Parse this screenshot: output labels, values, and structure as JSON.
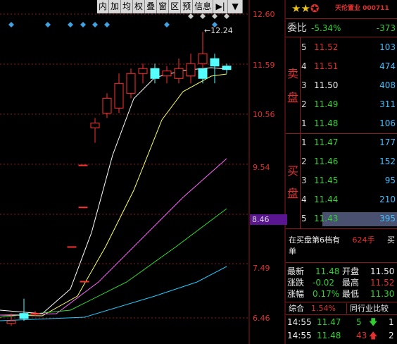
{
  "toolbar": [
    "内",
    "加",
    "均",
    "权",
    "叠",
    "窗",
    "区",
    "预",
    "信息",
    "▶|",
    "▼"
  ],
  "price_ticks": [
    "12.60",
    "11.59",
    "10.56",
    "9.54",
    "8.46",
    "7.49",
    "6.46"
  ],
  "current_price_label": "8.46",
  "high_marker": "←12.24",
  "chart_data": {
    "type": "candlestick",
    "candles": [
      {
        "o": 6.35,
        "h": 6.55,
        "l": 6.3,
        "c": 6.4
      },
      {
        "o": 6.55,
        "h": 6.85,
        "l": 6.4,
        "c": 6.45
      },
      {
        "o": 6.55,
        "h": 6.6,
        "l": 6.5,
        "c": 6.55
      },
      {
        "o": 7.2,
        "h": 7.2,
        "l": 7.2,
        "c": 7.2
      },
      {
        "o": 7.9,
        "h": 7.9,
        "l": 7.9,
        "c": 7.9
      },
      {
        "o": 8.7,
        "h": 8.7,
        "l": 8.7,
        "c": 8.7
      },
      {
        "o": 9.55,
        "h": 9.55,
        "l": 9.55,
        "c": 9.55
      },
      {
        "o": 10.3,
        "h": 10.5,
        "l": 10.0,
        "c": 10.4
      },
      {
        "o": 10.6,
        "h": 11.0,
        "l": 10.5,
        "c": 10.9
      },
      {
        "o": 10.7,
        "h": 11.4,
        "l": 10.6,
        "c": 11.2
      },
      {
        "o": 11.0,
        "h": 11.5,
        "l": 10.9,
        "c": 11.4
      },
      {
        "o": 11.4,
        "h": 11.6,
        "l": 11.2,
        "c": 11.5
      },
      {
        "o": 11.5,
        "h": 11.6,
        "l": 11.2,
        "c": 11.3
      },
      {
        "o": 11.35,
        "h": 11.55,
        "l": 11.2,
        "c": 11.45
      },
      {
        "o": 11.3,
        "h": 11.7,
        "l": 11.2,
        "c": 11.5
      },
      {
        "o": 11.35,
        "h": 11.7,
        "l": 11.2,
        "c": 11.5
      },
      {
        "o": 11.5,
        "h": 11.7,
        "l": 11.2,
        "c": 11.3
      },
      {
        "o": 11.35,
        "h": 11.8,
        "l": 11.2,
        "c": 11.6
      },
      {
        "o": 11.6,
        "h": 12.24,
        "l": 11.5,
        "c": 11.8
      },
      {
        "o": 11.7,
        "h": 11.8,
        "l": 11.2,
        "c": 11.55
      },
      {
        "o": 11.55,
        "h": 11.6,
        "l": 11.4,
        "c": 11.48
      }
    ]
  },
  "stars_count": 2,
  "stock_name": "天伦置业 000711",
  "weibi": {
    "label": "委比",
    "pct": "-5.34%",
    "diff": "-373"
  },
  "sell_label": [
    "卖",
    "盘"
  ],
  "buy_label": [
    "买",
    "盘"
  ],
  "sell": [
    {
      "lvl": "5",
      "price": "11.52",
      "vol": "103",
      "color": "red"
    },
    {
      "lvl": "4",
      "price": "11.51",
      "vol": "474",
      "color": "red"
    },
    {
      "lvl": "3",
      "price": "11.50",
      "vol": "408",
      "color": "white"
    },
    {
      "lvl": "2",
      "price": "11.49",
      "vol": "311",
      "color": "green"
    },
    {
      "lvl": "1",
      "price": "11.48",
      "vol": "106",
      "color": "green"
    }
  ],
  "buy": [
    {
      "lvl": "1",
      "price": "11.47",
      "vol": "177",
      "color": "green"
    },
    {
      "lvl": "2",
      "price": "11.46",
      "vol": "152",
      "color": "green"
    },
    {
      "lvl": "3",
      "price": "11.45",
      "vol": "95",
      "color": "green"
    },
    {
      "lvl": "4",
      "price": "11.44",
      "vol": "210",
      "color": "green"
    },
    {
      "lvl": "5",
      "price": "11.43",
      "vol": "395",
      "color": "green"
    }
  ],
  "depth6": {
    "text": "在买盘第6档有",
    "vol": "624手",
    "more": "买单"
  },
  "stats": {
    "latest_label": "最新",
    "latest": "11.48",
    "open_label": "开盘",
    "open": "11.50",
    "change_label": "涨跌",
    "change": "-0.02",
    "high_label": "最高",
    "high": "11.52",
    "pct_label": "涨幅",
    "pct": "0.17%",
    "low_label": "最低",
    "low": "11.30"
  },
  "tabs": {
    "composite": "综合",
    "composite_pct": "1.54%",
    "peer": "同行业比较"
  },
  "ticks": [
    {
      "time": "14:55",
      "price": "11.47",
      "vol": "5",
      "dir": "down",
      "extra": "1"
    },
    {
      "time": "14:55",
      "price": "11.48",
      "vol": "43",
      "dir": "up",
      "extra": "2"
    }
  ]
}
